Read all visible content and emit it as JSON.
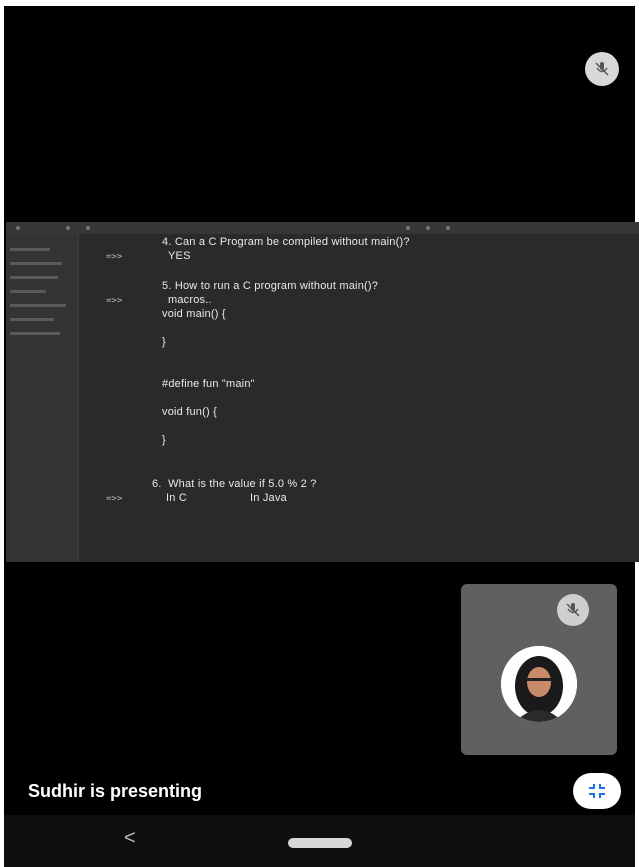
{
  "call": {
    "presenting_text": "Sudhir is presenting",
    "presenter_mic_icon": "mic-off-icon",
    "self_mic_icon": "mic-off-icon",
    "fullscreen_icon": "minimize-screen-icon",
    "nav": {
      "back_label": "<"
    }
  },
  "shared_screen": {
    "lines": [
      "4. Can a C Program be compiled without main()?",
      "YES",
      "5. How to run a C program without main()?",
      "macros..",
      "void main() {",
      "}",
      "#define fun \"main\"",
      "void fun() {",
      "}",
      "6.  What is the value if 5.0 % 2 ?",
      "In C",
      "In Java"
    ],
    "arrows": [
      "=>>",
      "=>>",
      "=>>"
    ]
  },
  "colors": {
    "background": "#000000",
    "share_bg": "#2a2a2a",
    "self_tile_bg": "#606060"
  }
}
